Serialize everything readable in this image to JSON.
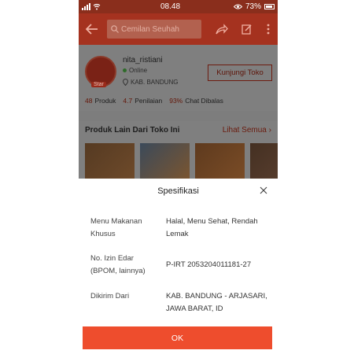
{
  "status_bar": {
    "time": "08.48",
    "battery": "73%"
  },
  "header": {
    "search_placeholder": "Cemilan Seuhah"
  },
  "shop": {
    "name": "nita_ristiani",
    "status": "Online",
    "location": "KAB. BANDUNG",
    "visit_label": "Kunjungi Toko",
    "badge": "Star",
    "stats": [
      {
        "num": "48",
        "label": "Produk"
      },
      {
        "num": "4.7",
        "label": "Penilaian"
      },
      {
        "num": "93%",
        "label": "Chat Dibalas"
      }
    ]
  },
  "other_products": {
    "title": "Produk Lain Dari Toko Ini",
    "see_all": "Lihat Semua"
  },
  "sheet": {
    "title": "Spesifikasi",
    "rows": [
      {
        "key": "Menu Makanan Khusus",
        "value": "Halal, Menu Sehat, Rendah Lemak"
      },
      {
        "key": "No. Izin Edar (BPOM, lainnya)",
        "value": "P-IRT 2053204011181-27"
      },
      {
        "key": "Dikirim Dari",
        "value": "KAB. BANDUNG - ARJASARI, JAWA BARAT, ID"
      }
    ],
    "ok_label": "OK"
  },
  "colors": {
    "accent": "#ee4d2d"
  }
}
